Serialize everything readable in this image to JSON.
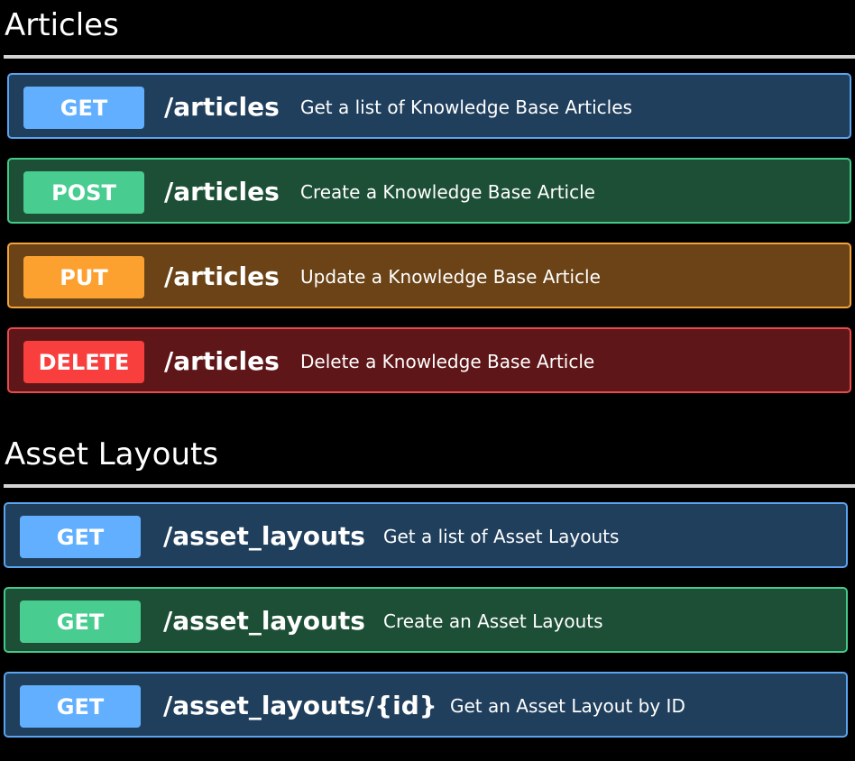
{
  "sections": [
    {
      "title": "Articles",
      "endpoints": [
        {
          "method": "GET",
          "path": "/articles",
          "description": "Get a list of Knowledge Base Articles"
        },
        {
          "method": "POST",
          "path": "/articles",
          "description": "Create a Knowledge Base Article"
        },
        {
          "method": "PUT",
          "path": "/articles",
          "description": "Update a Knowledge Base Article"
        },
        {
          "method": "DELETE",
          "path": "/articles",
          "description": "Delete a Knowledge Base Article"
        }
      ]
    },
    {
      "title": "Asset Layouts",
      "endpoints": [
        {
          "method": "GET",
          "path": "/asset_layouts",
          "description": "Get a list of Asset Layouts"
        },
        {
          "method": "GET",
          "path": "/asset_layouts",
          "description": "Create an Asset Layouts"
        },
        {
          "method": "GET",
          "path": "/asset_layouts/{id}",
          "description": "Get an Asset Layout by ID"
        }
      ]
    }
  ],
  "colors": {
    "background": "#000000",
    "divider": "#d4d4d4",
    "get_badge": "#61affe",
    "post_badge": "#49cc90",
    "put_badge": "#fca130",
    "delete_badge": "#f93e3e",
    "get_row_bg": "#203f5c",
    "post_row_bg": "#1d4f36",
    "put_row_bg": "#6b4316",
    "delete_row_bg": "#5f1618"
  }
}
